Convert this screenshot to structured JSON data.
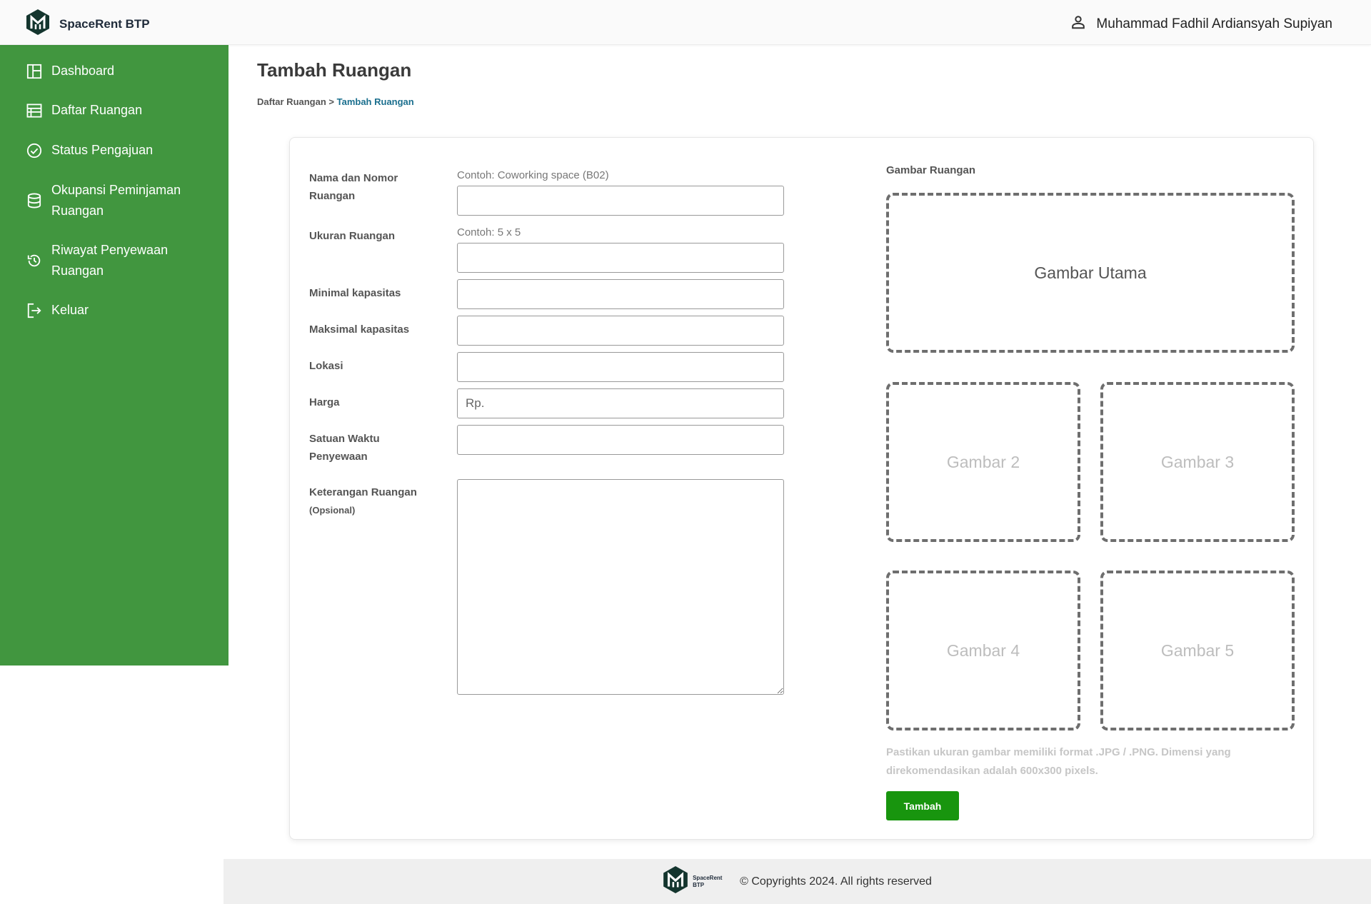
{
  "app": {
    "name": "SpaceRent BTP",
    "footer_logo_text": "SpaceRent BTP"
  },
  "user": {
    "name": "Muhammad Fadhil Ardiansyah Supiyan",
    "icon": "user-icon"
  },
  "sidebar": {
    "items": [
      {
        "label": "Dashboard",
        "icon": "dashboard-icon"
      },
      {
        "label": "Daftar Ruangan",
        "icon": "table-list-icon"
      },
      {
        "label": "Status Pengajuan",
        "icon": "check-circle-icon"
      },
      {
        "label": "Okupansi Peminjaman Ruangan",
        "icon": "database-icon"
      },
      {
        "label": "Riwayat Penyewaan Ruangan",
        "icon": "history-icon"
      },
      {
        "label": "Keluar",
        "icon": "logout-icon"
      }
    ]
  },
  "page": {
    "title": "Tambah Ruangan",
    "breadcrumb": {
      "parent": "Daftar Ruangan",
      "separator": " > ",
      "current": "Tambah Ruangan"
    }
  },
  "form": {
    "nama": {
      "label": "Nama dan Nomor Ruangan",
      "hint": "Contoh: Coworking space (B02)",
      "value": ""
    },
    "ukuran": {
      "label": "Ukuran Ruangan",
      "hint": "Contoh: 5 x 5",
      "value": ""
    },
    "min_kapasitas": {
      "label": "Minimal kapasitas",
      "value": ""
    },
    "max_kapasitas": {
      "label": "Maksimal kapasitas",
      "value": ""
    },
    "lokasi": {
      "label": "Lokasi",
      "value": ""
    },
    "harga": {
      "label": "Harga",
      "placeholder": "Rp.",
      "value": ""
    },
    "satuan_waktu": {
      "label": "Satuan Waktu Penyewaan",
      "value": ""
    },
    "keterangan": {
      "label": "Keterangan Ruangan",
      "sublabel": "(Opsional)",
      "value": ""
    }
  },
  "images": {
    "title": "Gambar Ruangan",
    "slots": [
      "Gambar Utama",
      "Gambar 2",
      "Gambar 3",
      "Gambar 4",
      "Gambar 5"
    ],
    "note": "Pastikan ukuran gambar memiliki format .JPG / .PNG. Dimensi yang direkomendasikan adalah 600x300 pixels.",
    "submit_label": "Tambah"
  },
  "footer": {
    "copyright": "© Copyrights 2024. All rights reserved"
  },
  "colors": {
    "sidebar": "#41963f",
    "submit": "#18950e",
    "breadcrumb_active": "#1b6f8e"
  }
}
